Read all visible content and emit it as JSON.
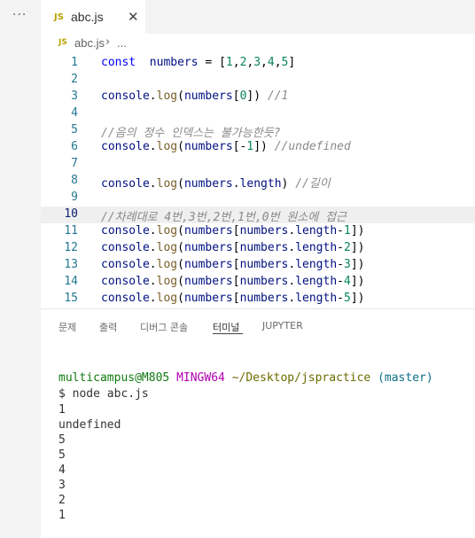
{
  "sidebar": {
    "more_label": "···"
  },
  "tab": {
    "icon_text": "JS",
    "label": "abc.js",
    "close_glyph": "✕"
  },
  "breadcrumb": {
    "icon_text": "JS",
    "file": "abc.js",
    "separator": "›",
    "ellipsis": "..."
  },
  "editor": {
    "current_line": 10,
    "lines": [
      {
        "n": "1",
        "parts": [
          [
            "kw",
            "const"
          ],
          [
            "",
            "  "
          ],
          [
            "var",
            "numbers"
          ],
          [
            "",
            " = ["
          ],
          [
            "num",
            "1"
          ],
          [
            "",
            ","
          ],
          [
            "num",
            "2"
          ],
          [
            "",
            ","
          ],
          [
            "num",
            "3"
          ],
          [
            "",
            ","
          ],
          [
            "num",
            "4"
          ],
          [
            "",
            ","
          ],
          [
            "num",
            "5"
          ],
          [
            "",
            "]"
          ]
        ]
      },
      {
        "n": "2",
        "parts": []
      },
      {
        "n": "3",
        "parts": [
          [
            "var",
            "console"
          ],
          [
            "",
            "."
          ],
          [
            "fn",
            "log"
          ],
          [
            "",
            "("
          ],
          [
            "var",
            "numbers"
          ],
          [
            "",
            "["
          ],
          [
            "num",
            "0"
          ],
          [
            "",
            "]) "
          ],
          [
            "cmt",
            "//1"
          ]
        ]
      },
      {
        "n": "4",
        "parts": []
      },
      {
        "n": "5",
        "parts": [
          [
            "cmt",
            "//음의 정수 인덱스는 불가능한듯?"
          ]
        ]
      },
      {
        "n": "6",
        "parts": [
          [
            "var",
            "console"
          ],
          [
            "",
            "."
          ],
          [
            "fn",
            "log"
          ],
          [
            "",
            "("
          ],
          [
            "var",
            "numbers"
          ],
          [
            "",
            "[-"
          ],
          [
            "num",
            "1"
          ],
          [
            "",
            "]) "
          ],
          [
            "cmt",
            "//undefined"
          ]
        ]
      },
      {
        "n": "7",
        "parts": []
      },
      {
        "n": "8",
        "parts": [
          [
            "var",
            "console"
          ],
          [
            "",
            "."
          ],
          [
            "fn",
            "log"
          ],
          [
            "",
            "("
          ],
          [
            "var",
            "numbers"
          ],
          [
            "",
            "."
          ],
          [
            "prop",
            "length"
          ],
          [
            "",
            ") "
          ],
          [
            "cmt",
            "//길이"
          ]
        ]
      },
      {
        "n": "9",
        "parts": []
      },
      {
        "n": "10",
        "parts": [
          [
            "cmt",
            "//차례대로 4번,3번,2번,1번,0번 원소에 접근"
          ]
        ]
      },
      {
        "n": "11",
        "parts": [
          [
            "var",
            "console"
          ],
          [
            "",
            "."
          ],
          [
            "fn",
            "log"
          ],
          [
            "",
            "("
          ],
          [
            "var",
            "numbers"
          ],
          [
            "",
            "["
          ],
          [
            "var",
            "numbers"
          ],
          [
            "",
            "."
          ],
          [
            "prop",
            "length"
          ],
          [
            "",
            "-"
          ],
          [
            "num",
            "1"
          ],
          [
            "",
            "])"
          ]
        ]
      },
      {
        "n": "12",
        "parts": [
          [
            "var",
            "console"
          ],
          [
            "",
            "."
          ],
          [
            "fn",
            "log"
          ],
          [
            "",
            "("
          ],
          [
            "var",
            "numbers"
          ],
          [
            "",
            "["
          ],
          [
            "var",
            "numbers"
          ],
          [
            "",
            "."
          ],
          [
            "prop",
            "length"
          ],
          [
            "",
            "-"
          ],
          [
            "num",
            "2"
          ],
          [
            "",
            "])"
          ]
        ]
      },
      {
        "n": "13",
        "parts": [
          [
            "var",
            "console"
          ],
          [
            "",
            "."
          ],
          [
            "fn",
            "log"
          ],
          [
            "",
            "("
          ],
          [
            "var",
            "numbers"
          ],
          [
            "",
            "["
          ],
          [
            "var",
            "numbers"
          ],
          [
            "",
            "."
          ],
          [
            "prop",
            "length"
          ],
          [
            "",
            "-"
          ],
          [
            "num",
            "3"
          ],
          [
            "",
            "])"
          ]
        ]
      },
      {
        "n": "14",
        "parts": [
          [
            "var",
            "console"
          ],
          [
            "",
            "."
          ],
          [
            "fn",
            "log"
          ],
          [
            "",
            "("
          ],
          [
            "var",
            "numbers"
          ],
          [
            "",
            "["
          ],
          [
            "var",
            "numbers"
          ],
          [
            "",
            "."
          ],
          [
            "prop",
            "length"
          ],
          [
            "",
            "-"
          ],
          [
            "num",
            "4"
          ],
          [
            "",
            "])"
          ]
        ]
      },
      {
        "n": "15",
        "parts": [
          [
            "var",
            "console"
          ],
          [
            "",
            "."
          ],
          [
            "fn",
            "log"
          ],
          [
            "",
            "("
          ],
          [
            "var",
            "numbers"
          ],
          [
            "",
            "["
          ],
          [
            "var",
            "numbers"
          ],
          [
            "",
            "."
          ],
          [
            "prop",
            "length"
          ],
          [
            "",
            "-"
          ],
          [
            "num",
            "5"
          ],
          [
            "",
            "])"
          ]
        ]
      }
    ]
  },
  "panel": {
    "tabs": [
      "문제",
      "출력",
      "디버그 콘솔",
      "터미널",
      "JUPYTER"
    ],
    "active_tab": "터미널"
  },
  "terminal": {
    "prompt_user": "multicampus@M805",
    "prompt_env": "MINGW64",
    "prompt_path": "~/Desktop/jspractice",
    "prompt_branch": "(master)",
    "command": "$ node abc.js",
    "output": [
      "1",
      "undefined",
      "5",
      "5",
      "4",
      "3",
      "2",
      "1"
    ]
  },
  "colors": {
    "keyword": "#0000ff",
    "variable": "#001080",
    "function": "#795e26",
    "number": "#098658",
    "comment": "#8a8a8a",
    "line_number": "#237893"
  }
}
